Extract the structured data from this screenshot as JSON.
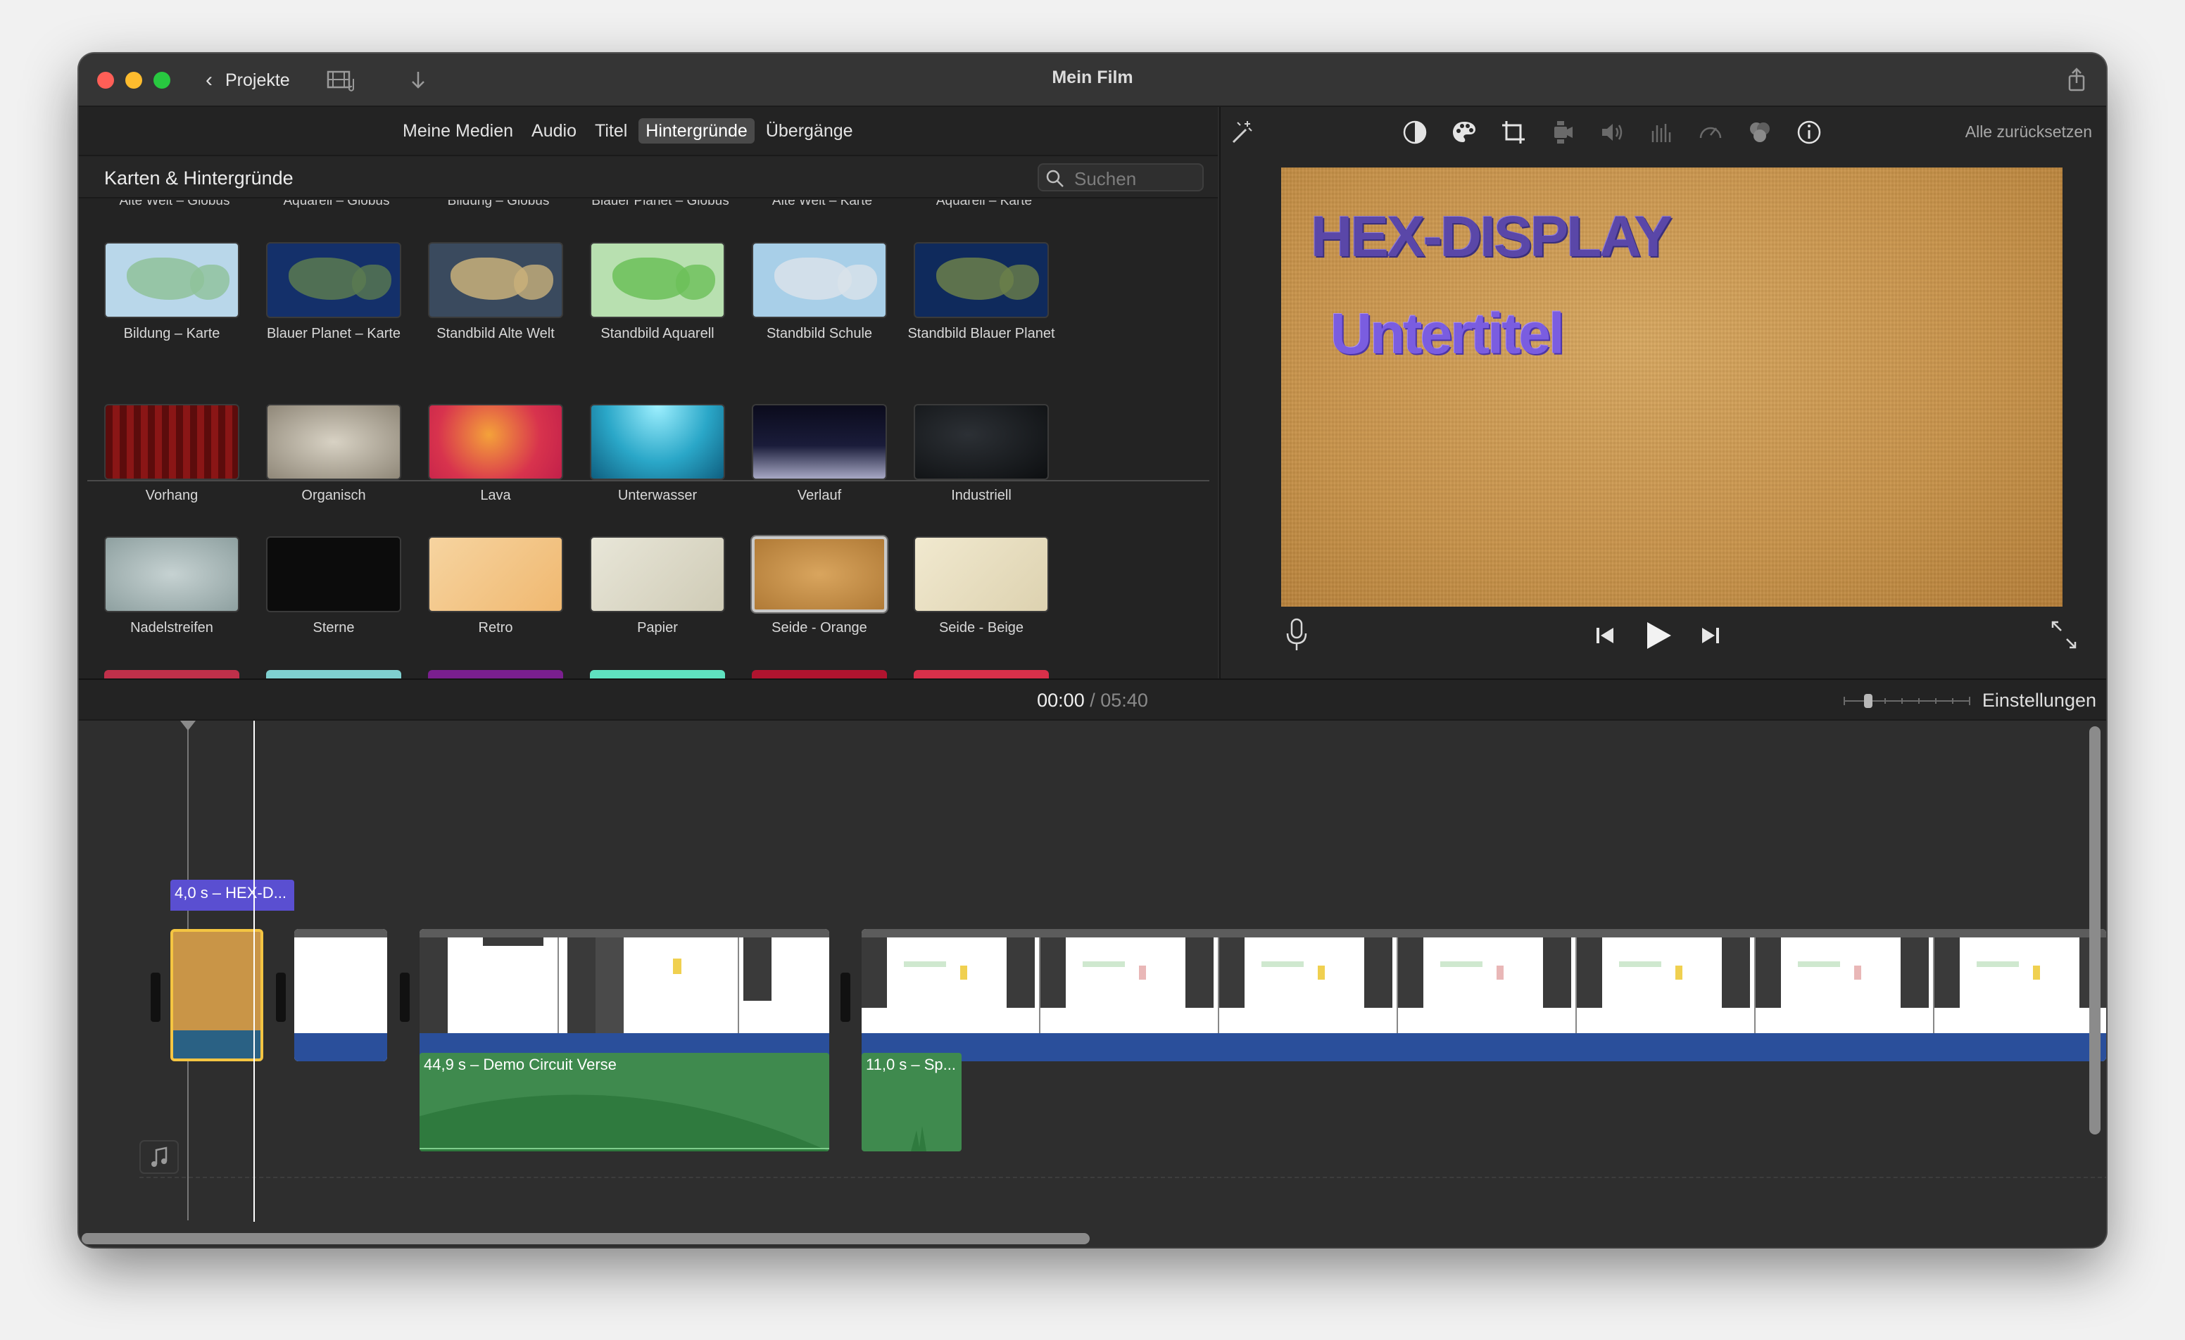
{
  "window": {
    "title": "Mein Film",
    "back_label": "Projekte",
    "traffic_lights": {
      "close": "#ff5f57",
      "minimize": "#febc2e",
      "zoom": "#28c840"
    }
  },
  "browser": {
    "tabs": [
      {
        "label": "Meine Medien",
        "active": false
      },
      {
        "label": "Audio",
        "active": false
      },
      {
        "label": "Titel",
        "active": false
      },
      {
        "label": "Hintergründe",
        "active": true
      },
      {
        "label": "Übergänge",
        "active": false
      }
    ],
    "category_title": "Karten & Hintergründe",
    "search_placeholder": "Suchen",
    "cut_row_labels": [
      "Alte Welt – Globus",
      "Aquarell – Globus",
      "Bildung – Globus",
      "Blauer Planet – Globus",
      "Alte Welt – Karte",
      "Aquarell – Karte"
    ],
    "maps": [
      {
        "label": "Bildung – Karte",
        "colors": [
          "#b9d7ea",
          "#8fc29a"
        ]
      },
      {
        "label": "Blauer Planet – Karte",
        "colors": [
          "#14306a",
          "#5a7a50"
        ]
      },
      {
        "label": "Standbild Alte Welt",
        "colors": [
          "#3a4a5e",
          "#c9b07a"
        ]
      },
      {
        "label": "Standbild Aquarell",
        "colors": [
          "#b8e0b0",
          "#6bbf59"
        ]
      },
      {
        "label": "Standbild Schule",
        "colors": [
          "#a8cfe8",
          "#d9e2ea"
        ]
      },
      {
        "label": "Standbild Blauer Planet",
        "colors": [
          "#0f2a5c",
          "#6b7f4a"
        ]
      }
    ],
    "backgrounds_row1": [
      {
        "label": "Vorhang",
        "bg": "repeating-linear-gradient(90deg,#5c0c0c 0 10px,#8a1616 10px 20px)"
      },
      {
        "label": "Organisch",
        "bg": "radial-gradient(ellipse at center,#d8d2c4,#8f8778)"
      },
      {
        "label": "Lava",
        "bg": "radial-gradient(circle at 45% 40%,#f4a23a,#d8334d 60%,#c2204a)"
      },
      {
        "label": "Unterwasser",
        "bg": "radial-gradient(ellipse at 50% 0%,#9ef0ff,#2aa7c8 55%,#0f5f80)"
      },
      {
        "label": "Verlauf",
        "bg": "linear-gradient(180deg,#0b0b1c,#1a1c3a 55%,#a7a8c4)"
      },
      {
        "label": "Industriell",
        "bg": "radial-gradient(ellipse at 40% 40%,#2c3035,#0d0f11)"
      }
    ],
    "backgrounds_row2": [
      {
        "label": "Nadelstreifen",
        "bg": "radial-gradient(ellipse at center,#c6d2d2,#8ea0a0)",
        "selected": false
      },
      {
        "label": "Sterne",
        "bg": "#0c0c0c",
        "selected": false
      },
      {
        "label": "Retro",
        "bg": "linear-gradient(135deg,#f6d4a0,#f0b870)",
        "selected": false
      },
      {
        "label": "Papier",
        "bg": "linear-gradient(135deg,#e8e6d8,#cfcbb6)",
        "selected": false
      },
      {
        "label": "Seide - Orange",
        "bg": "radial-gradient(ellipse at center,#d9a55e,#b07a36)",
        "selected": true
      },
      {
        "label": "Seide - Beige",
        "bg": "linear-gradient(135deg,#f1e9cf,#ddd2b0)",
        "selected": false
      }
    ],
    "cut_row_colors": [
      "#c0304a",
      "#7fd0d0",
      "#7a1f8f",
      "#5fe2c0",
      "#b0142f",
      "#d8304a"
    ]
  },
  "viewer": {
    "reset_label": "Alle zurücksetzen",
    "tools": [
      "balance-icon",
      "palette-icon",
      "crop-icon",
      "stabilize-icon",
      "volume-icon",
      "equalizer-icon",
      "speed-icon",
      "overlay-icon",
      "info-icon"
    ],
    "preview_title": "HEX-DISPLAY",
    "preview_subtitle": "Untertitel"
  },
  "timeline": {
    "current_time": "00:00",
    "separator": "/",
    "total_time": "05:40",
    "settings_label": "Einstellungen",
    "title_clip_label": "4,0 s – HEX-D...",
    "audio_clips": [
      {
        "label": "44,9 s – Demo Circuit Verse"
      },
      {
        "label": "11,0 s – Sp..."
      }
    ]
  }
}
